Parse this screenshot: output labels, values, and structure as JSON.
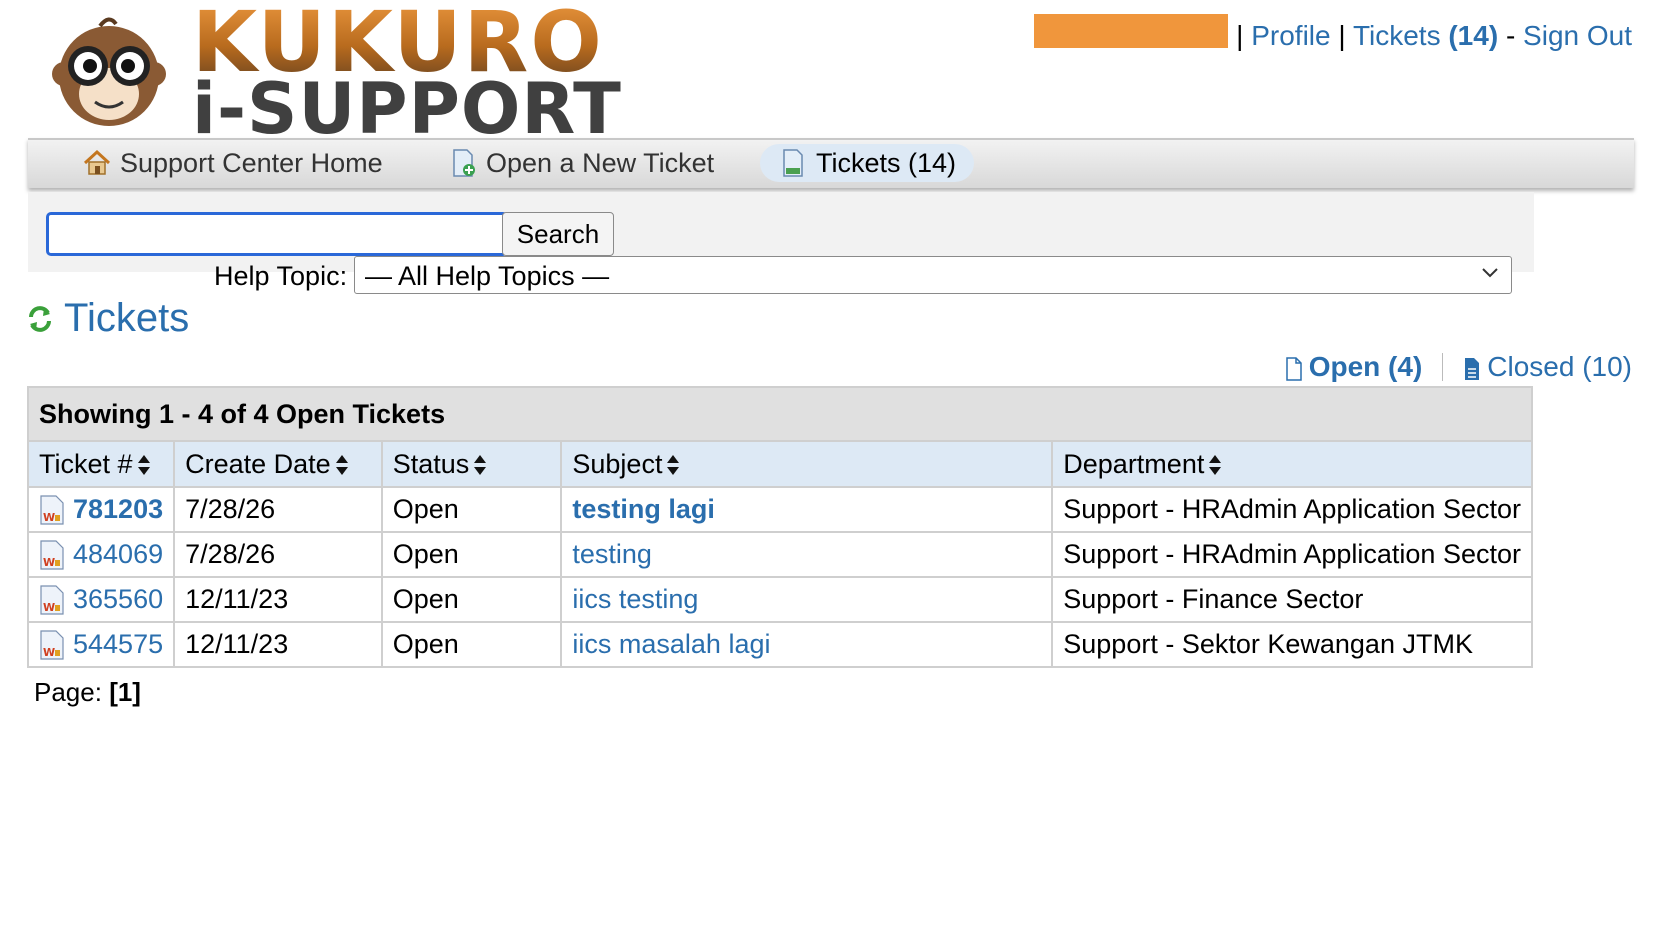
{
  "logo": {
    "line1": "KUKURO",
    "line2": "i-SUPPORT"
  },
  "top_links": {
    "separator": "|",
    "profile": "Profile",
    "tickets_label": "Tickets",
    "tickets_count": "(14)",
    "dash": "-",
    "sign_out": "Sign Out",
    "user_box_color": "#f0963c"
  },
  "nav": [
    {
      "label": "Support Center Home",
      "icon": "home-icon",
      "active": false
    },
    {
      "label": "Open a New Ticket",
      "icon": "new-ticket-icon",
      "active": false
    },
    {
      "label": "Tickets (14)",
      "icon": "tickets-icon",
      "active": true
    }
  ],
  "search": {
    "value": "",
    "button": "Search"
  },
  "help_topic": {
    "label": "Help Topic:",
    "selected": "— All Help Topics —"
  },
  "title": "Tickets",
  "filters": {
    "open": "Open (4)",
    "closed": "Closed (10)"
  },
  "table": {
    "caption": "Showing 1 - 4 of 4 Open Tickets",
    "columns": [
      "Ticket #",
      "Create Date",
      "Status",
      "Subject",
      "Department"
    ],
    "rows": [
      {
        "ticket": "781203",
        "date": "7/28/26",
        "status": "Open",
        "subject": "testing lagi",
        "department": "Support - HRAdmin Application Sector"
      },
      {
        "ticket": "484069",
        "date": "7/28/26",
        "status": "Open",
        "subject": "testing",
        "department": "Support - HRAdmin Application Sector"
      },
      {
        "ticket": "365560",
        "date": "12/11/23",
        "status": "Open",
        "subject": "iics testing",
        "department": "Support - Finance Sector"
      },
      {
        "ticket": "544575",
        "date": "12/11/23",
        "status": "Open",
        "subject": "iics masalah lagi",
        "department": "Support - Sektor Kewangan JTMK"
      }
    ]
  },
  "pager": {
    "label": "Page:",
    "current": "[1]"
  },
  "colors": {
    "link": "#2a6ead",
    "header_blue": "#dde9f5",
    "accent_orange": "#f0963c"
  }
}
